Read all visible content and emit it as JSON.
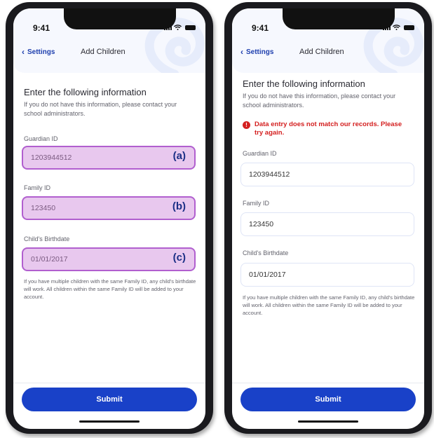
{
  "screens": [
    {
      "status_time": "9:41",
      "nav": {
        "back_label": "Settings",
        "title": "Add Children"
      },
      "heading": "Enter the following information",
      "subtext": "If you do not have this information, please contact your school administrators.",
      "fields": [
        {
          "label": "Guardian ID",
          "value": "1203944512",
          "tag": "(a)"
        },
        {
          "label": "Family ID",
          "value": "123450",
          "tag": "(b)"
        },
        {
          "label": "Child's Birthdate",
          "value": "01/01/2017",
          "tag": "(c)"
        }
      ],
      "note": "If you have multiple children with the same Family ID, any child's birthdate will work. All children within the same Family ID will be added to your account.",
      "submit_label": "Submit"
    },
    {
      "status_time": "9:41",
      "nav": {
        "back_label": "Settings",
        "title": "Add Children"
      },
      "heading": "Enter the following information",
      "subtext": "If you do not have this information, please contact your school administrators.",
      "error": "Data entry does not match our records. Please try again.",
      "fields": [
        {
          "label": "Guardian ID",
          "value": "1203944512"
        },
        {
          "label": "Family ID",
          "value": "123450"
        },
        {
          "label": "Child's Birthdate",
          "value": "01/01/2017"
        }
      ],
      "note": "If you have multiple children with the same Family ID, any child's birthdate will work. All children within the same Family ID will be added to your account.",
      "submit_label": "Submit"
    }
  ],
  "colors": {
    "accent": "#1941c8",
    "nav_link": "#1e3fae",
    "error": "#d42020",
    "highlight_fill": "#e8c8ee",
    "highlight_border": "#b15fcf",
    "tag_text": "#1b2f86"
  }
}
